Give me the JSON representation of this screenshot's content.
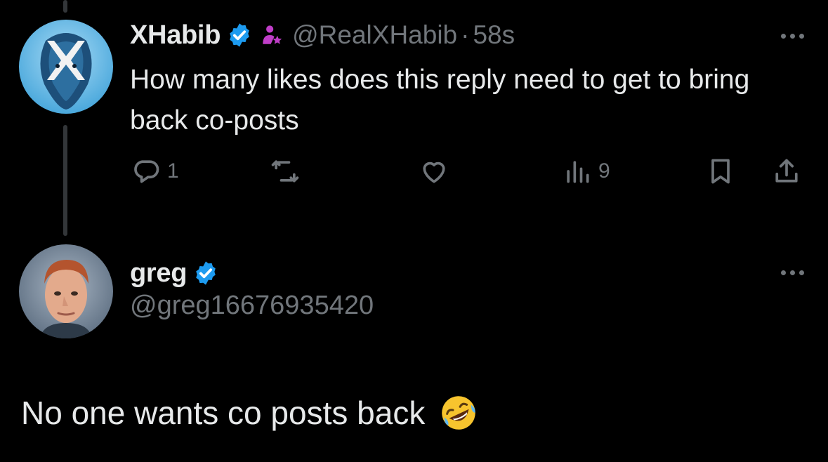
{
  "post": {
    "author_name": "XHabib",
    "handle": "@RealXHabib",
    "separator": "·",
    "time": "58s",
    "text": "How many likes does this reply need to get to bring back co-posts",
    "reply_count": "1",
    "views_count": "9"
  },
  "reply": {
    "author_name": "greg",
    "handle": "@greg16676935420",
    "text": "No one wants co posts back"
  },
  "colors": {
    "background": "#000000",
    "text_primary": "#e7e9ea",
    "text_secondary": "#71767b",
    "verified_blue": "#1d9bf0",
    "affiliate_purple": "#c03ec8",
    "thread_line": "#333639"
  },
  "icons": [
    "verified-badge-icon",
    "affiliate-icon",
    "more-icon",
    "reply-icon",
    "repost-icon",
    "like-icon",
    "views-icon",
    "bookmark-icon",
    "share-icon",
    "rofl-emoji"
  ]
}
